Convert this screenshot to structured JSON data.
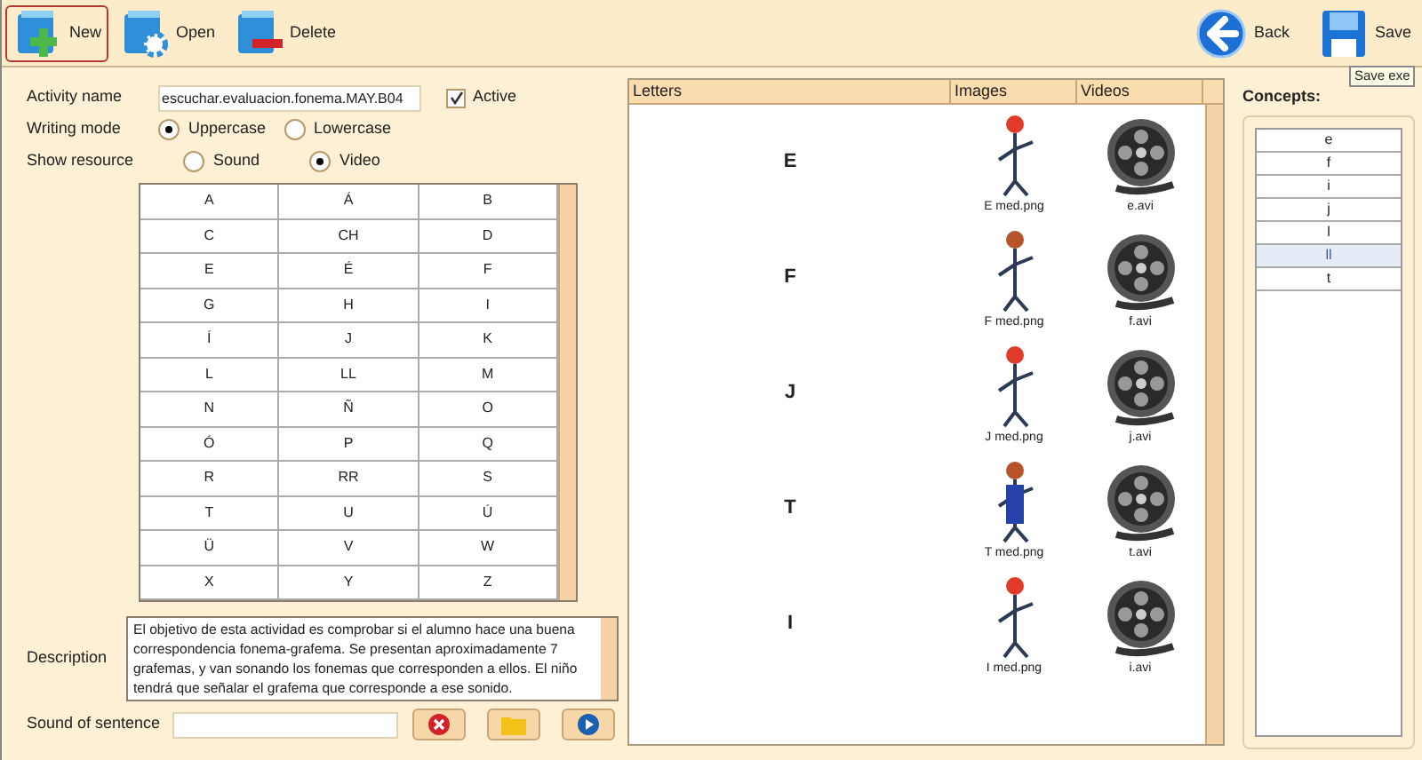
{
  "toolbar": {
    "left": [
      {
        "kind": "new",
        "label": "New",
        "selected": true
      },
      {
        "kind": "open",
        "label": "Open",
        "selected": false
      },
      {
        "kind": "delete",
        "label": "Delete",
        "selected": false
      }
    ],
    "right": [
      {
        "kind": "back",
        "label": "Back"
      },
      {
        "kind": "save",
        "label": "Save"
      }
    ],
    "tooltip": "Save exe"
  },
  "form": {
    "activity_name": {
      "label": "Activity name",
      "value": "escuchar.evaluacion.fonema.MAY.B04"
    },
    "active": {
      "label": "Active",
      "checked": true
    },
    "writing_mode": {
      "label": "Writing mode",
      "options": [
        {
          "label": "Uppercase",
          "selected": true
        },
        {
          "label": "Lowercase",
          "selected": false
        }
      ]
    },
    "show_resource": {
      "label": "Show resource",
      "options": [
        {
          "label": "Sound",
          "selected": false
        },
        {
          "label": "Video",
          "selected": true
        }
      ]
    },
    "letters": [
      [
        "A",
        "Á",
        "B"
      ],
      [
        "C",
        "CH",
        "D"
      ],
      [
        "E",
        "É",
        "F"
      ],
      [
        "G",
        "H",
        "I"
      ],
      [
        "Í",
        "J",
        "K"
      ],
      [
        "L",
        "LL",
        "M"
      ],
      [
        "N",
        "Ñ",
        "O"
      ],
      [
        "Ó",
        "P",
        "Q"
      ],
      [
        "R",
        "RR",
        "S"
      ],
      [
        "T",
        "U",
        "Ú"
      ],
      [
        "Ü",
        "V",
        "W"
      ],
      [
        "X",
        "Y",
        "Z"
      ]
    ],
    "description": {
      "label": "Description",
      "value": "El objetivo de esta actividad es comprobar si el alumno hace una buena correspondencia fonema-grafema. Se presentan aproximadamente 7 grafemas, y van sonando los fonemas que corresponden a ellos. El niño tendrá que señalar el grafema que corresponde a ese sonido."
    },
    "sound_of_sentence": {
      "label": "Sound of sentence"
    }
  },
  "table": {
    "columns": [
      "Letters",
      "Images",
      "Videos"
    ],
    "rows": [
      {
        "letter": "E",
        "image": "E med.png",
        "video": "e.avi"
      },
      {
        "letter": "F",
        "image": "F med.png",
        "video": "f.avi"
      },
      {
        "letter": "J",
        "image": "J med.png",
        "video": "j.avi"
      },
      {
        "letter": "T",
        "image": "T med.png",
        "video": "t.avi"
      },
      {
        "letter": "I",
        "image": "I med.png",
        "video": "i.avi"
      }
    ]
  },
  "concepts": {
    "title": "Concepts:",
    "items": [
      {
        "label": "e",
        "selected": false
      },
      {
        "label": "f",
        "selected": false
      },
      {
        "label": "i",
        "selected": false
      },
      {
        "label": "j",
        "selected": false
      },
      {
        "label": "l",
        "selected": false
      },
      {
        "label": "ll",
        "selected": true
      },
      {
        "label": "t",
        "selected": false
      }
    ]
  }
}
